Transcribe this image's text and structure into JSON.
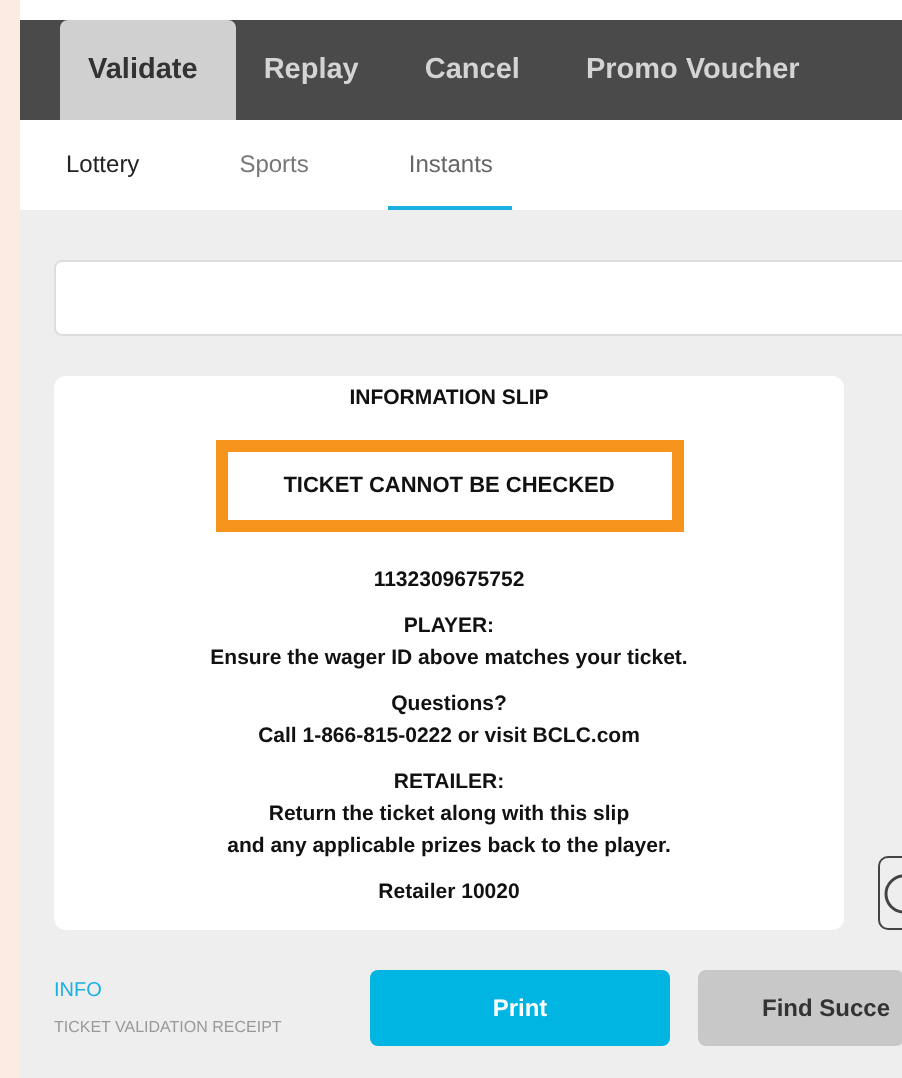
{
  "tabs": [
    {
      "label": "Validate",
      "selected": true
    },
    {
      "label": "Replay",
      "selected": false
    },
    {
      "label": "Cancel",
      "selected": false
    },
    {
      "label": "Promo Voucher",
      "selected": false
    }
  ],
  "subtabs": [
    {
      "label": "Lottery",
      "selected": false
    },
    {
      "label": "Sports",
      "selected": false
    },
    {
      "label": "Instants",
      "selected": true
    }
  ],
  "slip": {
    "groups": [
      [
        "INFORMATION SLIP"
      ],
      [
        "1132309675752"
      ],
      [
        "PLAYER:",
        "Ensure the wager ID above matches your ticket."
      ],
      [
        "Questions?",
        "Call 1-866-815-0222 or visit BCLC.com"
      ],
      [
        "RETAILER:",
        "Return the ticket along with this slip",
        "and any applicable prizes back to the player."
      ],
      [
        "Retailer 10020"
      ]
    ]
  },
  "alert": {
    "text": "TICKET CANNOT BE CHECKED"
  },
  "footer": {
    "label": "INFO",
    "caption": "TICKET VALIDATION RECEIPT"
  },
  "buttons": [
    {
      "label": "Print",
      "kind": "primary"
    },
    {
      "label": "Find Succe",
      "kind": "secondary"
    }
  ]
}
